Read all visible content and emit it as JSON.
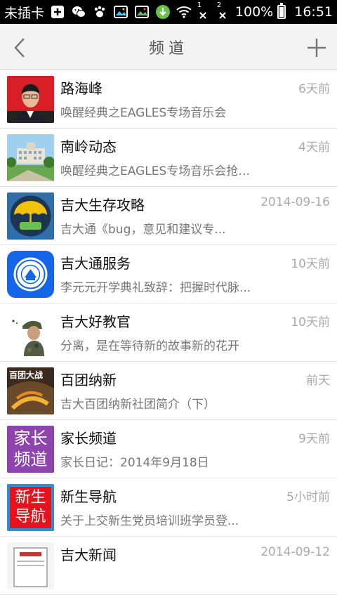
{
  "status_bar": {
    "carrier": "未插卡",
    "battery": "100%",
    "time": "16:51",
    "sim1": "1",
    "sim2": "2"
  },
  "header": {
    "title": "频道",
    "back_icon": "chevron-left-icon",
    "add_icon": "plus-icon"
  },
  "channels": [
    {
      "name": "路海峰",
      "time": "6天前",
      "desc": "唤醒经典之EAGLES专场音乐会",
      "avatar": "portrait-man"
    },
    {
      "name": "南岭动态",
      "time": "4天前",
      "desc": "唤醒经典之EAGLES专场音乐会抢票...",
      "avatar": "campus-building"
    },
    {
      "name": "吉大生存攻略",
      "time": "2014-09-16",
      "desc": "吉大通《bug，意见和建议专...",
      "avatar": "umbrella-logo"
    },
    {
      "name": "吉大通服务",
      "time": "10天前",
      "desc": "李元元开学典礼致辞：把握时代脉...",
      "avatar": "university-seal"
    },
    {
      "name": "吉大好教官",
      "time": "10天前",
      "desc": "分离，是在等待新的故事新的花开",
      "avatar": "soldier"
    },
    {
      "name": "百团纳新",
      "time": "前天",
      "desc": "吉大百团纳新社团简介（下）",
      "avatar": "poster",
      "avatar_text": "百团大战"
    },
    {
      "name": "家长频道",
      "time": "9天前",
      "desc": "家长日记：2014年9月18日",
      "avatar": "text-badge",
      "avatar_text_1": "家长",
      "avatar_text_2": "频道"
    },
    {
      "name": "新生导航",
      "time": "5小时前",
      "desc": "关于上交新生党员培训班学员登...",
      "avatar": "text-badge",
      "avatar_text_1": "新生",
      "avatar_text_2": "导航"
    },
    {
      "name": "吉大新闻",
      "time": "2014-09-12",
      "desc": "",
      "avatar": "newspaper"
    }
  ],
  "colors": {
    "header_bg": "#f3f3f3",
    "badge_purple": "#8e44ad",
    "badge_red": "#e8121c",
    "service_blue": "#1565e8"
  }
}
